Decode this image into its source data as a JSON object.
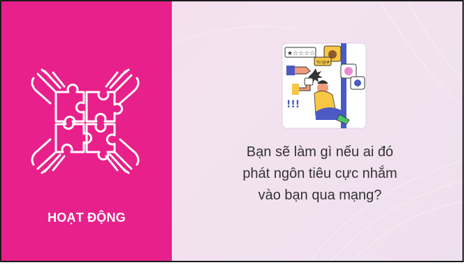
{
  "left_panel": {
    "icon": "puzzle-hands-icon",
    "label": "HOẠT ĐỘNG",
    "color": "#e8208b"
  },
  "main": {
    "illustration": "cyberbullying-illustration",
    "question_lines": [
      "Bạn sẽ làm gì nếu ai đó",
      "phát ngôn tiêu cực nhắm",
      "vào bạn qua mạng?"
    ]
  }
}
